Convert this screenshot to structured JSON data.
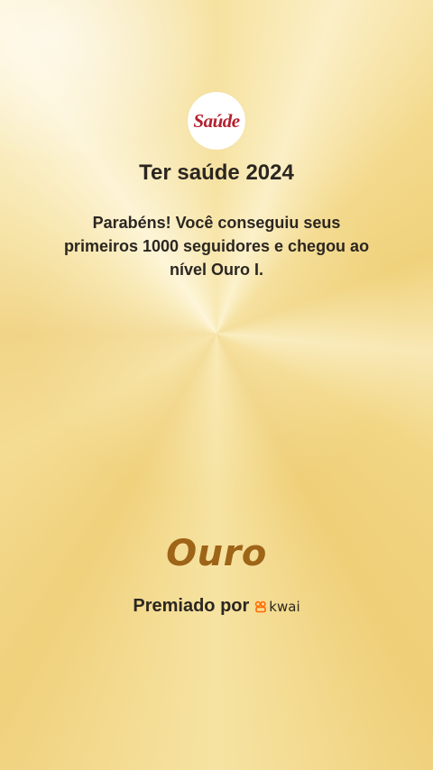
{
  "logo": {
    "text": "Saúde"
  },
  "channel": {
    "name": "Ter saúde 2024"
  },
  "message": "Parabéns! Você conseguiu seus primeiros 1000 seguidores e chegou ao nível Ouro I.",
  "level": {
    "name": "Ouro"
  },
  "award": {
    "label": "Premiado por",
    "brand": "kwai",
    "brand_icon": "kwai-logo-icon"
  },
  "colors": {
    "background_gold": "#f3d98a",
    "level_text": "#9e6417",
    "logo_red": "#b3202e",
    "brand_orange": "#ff6a00"
  }
}
